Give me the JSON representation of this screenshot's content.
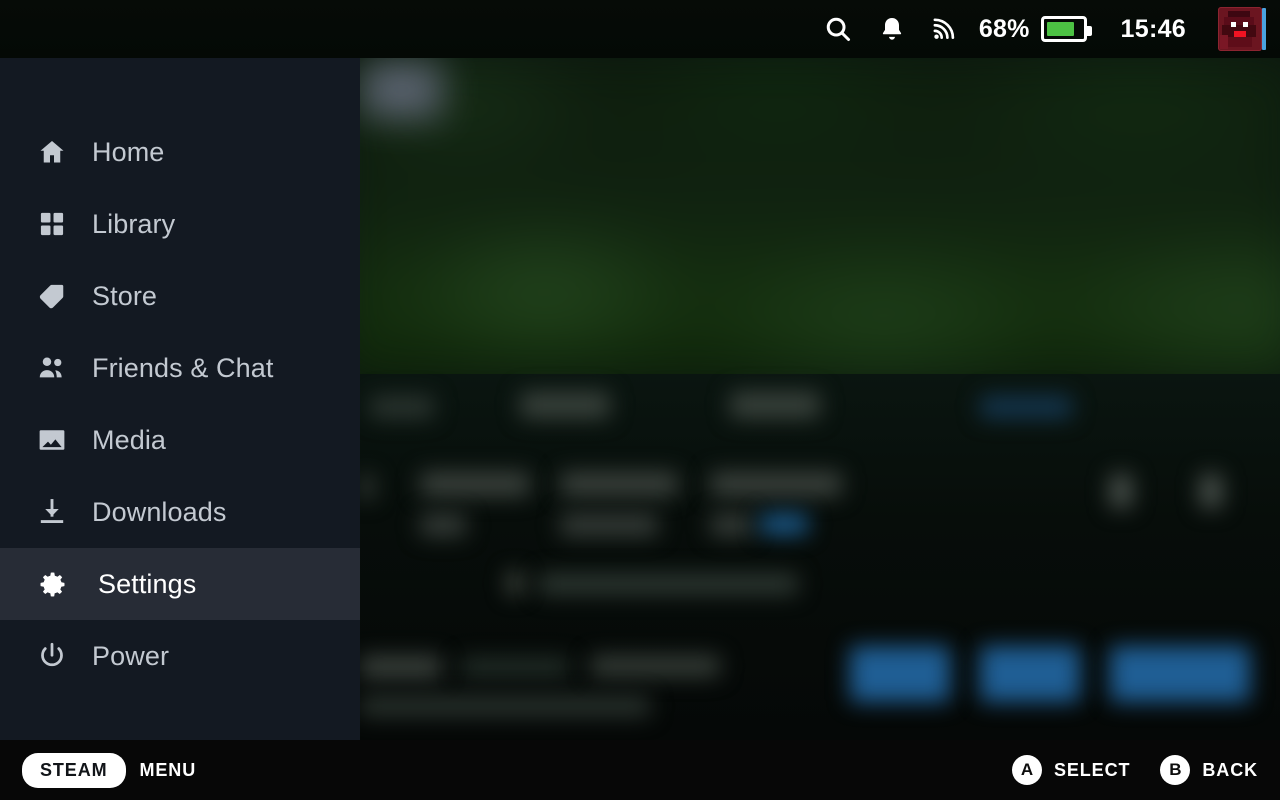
{
  "topbar": {
    "search_icon": "search-icon",
    "notifications_icon": "bell-icon",
    "network_icon": "wifi-icon",
    "battery_percent": "68%",
    "battery_level": 68,
    "battery_icon": "battery-icon",
    "clock": "15:46",
    "avatar_icon": "user-avatar"
  },
  "sidebar": {
    "items": [
      {
        "label": "Home",
        "icon": "home-icon",
        "active": false
      },
      {
        "label": "Library",
        "icon": "grid-icon",
        "active": false
      },
      {
        "label": "Store",
        "icon": "tag-icon",
        "active": false
      },
      {
        "label": "Friends & Chat",
        "icon": "people-icon",
        "active": false
      },
      {
        "label": "Media",
        "icon": "image-icon",
        "active": false
      },
      {
        "label": "Downloads",
        "icon": "download-icon",
        "active": false
      },
      {
        "label": "Settings",
        "icon": "gear-icon",
        "active": true
      },
      {
        "label": "Power",
        "icon": "power-icon",
        "active": false
      }
    ]
  },
  "footer": {
    "steam_label": "STEAM",
    "menu_label": "MENU",
    "hints": [
      {
        "button": "A",
        "label": "SELECT"
      },
      {
        "button": "B",
        "label": "BACK"
      }
    ]
  },
  "colors": {
    "sidebar_bg": "#131922",
    "sidebar_active_bg": "#272c36",
    "topbar_bg": "#050a06",
    "bottombar_bg": "#070707",
    "battery_green": "#4cc243",
    "accent_blue": "#4aa3e0",
    "text_primary": "#ffffff",
    "text_muted": "#c3c9d1"
  }
}
